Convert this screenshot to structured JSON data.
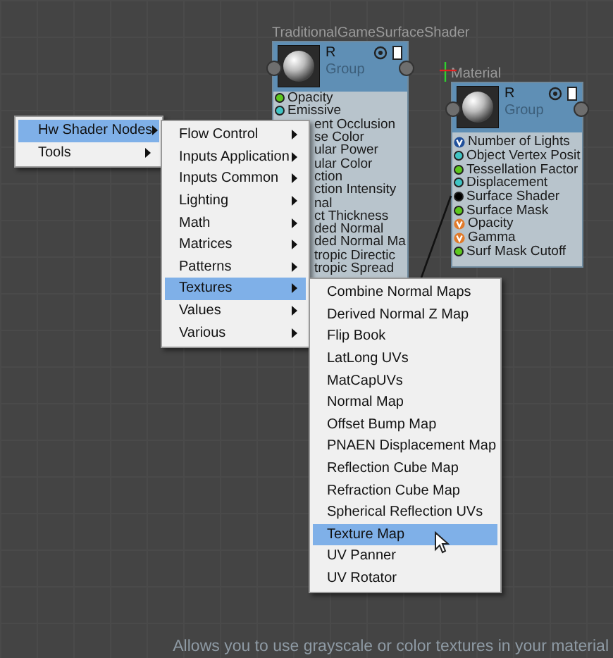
{
  "nodes": [
    {
      "title": "TraditionalGameSurfaceShader",
      "name": "R",
      "group": "Group",
      "ports": [
        {
          "label": "Opacity",
          "kind": "dot",
          "color": "#5cc81e"
        },
        {
          "label": "Emissive",
          "kind": "dot",
          "color": "#3fc4c4"
        },
        {
          "label": "ent Occlusion",
          "kind": "covered"
        },
        {
          "label": "se Color",
          "kind": "covered"
        },
        {
          "label": "ular Power",
          "kind": "covered"
        },
        {
          "label": "ular Color",
          "kind": "covered"
        },
        {
          "label": "ction",
          "kind": "covered"
        },
        {
          "label": "ction Intensity",
          "kind": "covered"
        },
        {
          "label": "nal",
          "kind": "covered"
        },
        {
          "label": "ct Thickness",
          "kind": "covered"
        },
        {
          "label": "ded Normal",
          "kind": "covered"
        },
        {
          "label": "ded Normal Ma",
          "kind": "covered"
        },
        {
          "label": "tropic Directic",
          "kind": "covered"
        },
        {
          "label": "tropic Spread",
          "kind": "covered"
        }
      ]
    },
    {
      "title": "Material",
      "name": "R",
      "group": "Group",
      "ports": [
        {
          "label": "Number of Lights",
          "kind": "v",
          "color": "#1f4f9a"
        },
        {
          "label": "Object Vertex Posit",
          "kind": "dot",
          "color": "#3fc4c4"
        },
        {
          "label": "Tessellation Factor",
          "kind": "dot",
          "color": "#5cc81e"
        },
        {
          "label": "Displacement",
          "kind": "dot",
          "color": "#3fc4c4"
        },
        {
          "label": "Surface Shader",
          "kind": "dot",
          "color": "#000000"
        },
        {
          "label": "Surface Mask",
          "kind": "dot",
          "color": "#5cc81e"
        },
        {
          "label": "Opacity",
          "kind": "v",
          "color": "#e07a2a"
        },
        {
          "label": "Gamma",
          "kind": "v",
          "color": "#e07a2a"
        },
        {
          "label": "Surf Mask Cutoff",
          "kind": "dot",
          "color": "#5cc81e"
        }
      ]
    }
  ],
  "menus": [
    [
      {
        "label": "Hw Shader Nodes",
        "selected": true,
        "submenu": true
      },
      {
        "label": "Tools",
        "selected": false,
        "submenu": true
      }
    ],
    [
      {
        "label": "Flow Control",
        "selected": false,
        "submenu": true
      },
      {
        "label": "Inputs Application",
        "selected": false,
        "submenu": true
      },
      {
        "label": "Inputs Common",
        "selected": false,
        "submenu": true
      },
      {
        "label": "Lighting",
        "selected": false,
        "submenu": true
      },
      {
        "label": "Math",
        "selected": false,
        "submenu": true
      },
      {
        "label": "Matrices",
        "selected": false,
        "submenu": true
      },
      {
        "label": "Patterns",
        "selected": false,
        "submenu": true
      },
      {
        "label": "Textures",
        "selected": true,
        "submenu": true
      },
      {
        "label": "Values",
        "selected": false,
        "submenu": true
      },
      {
        "label": "Various",
        "selected": false,
        "submenu": true
      }
    ],
    [
      {
        "label": "Combine Normal Maps",
        "selected": false,
        "submenu": false
      },
      {
        "label": "Derived Normal Z Map",
        "selected": false,
        "submenu": false
      },
      {
        "label": "Flip Book",
        "selected": false,
        "submenu": false
      },
      {
        "label": "LatLong UVs",
        "selected": false,
        "submenu": false
      },
      {
        "label": "MatCapUVs",
        "selected": false,
        "submenu": false
      },
      {
        "label": "Normal Map",
        "selected": false,
        "submenu": false
      },
      {
        "label": "Offset Bump Map",
        "selected": false,
        "submenu": false
      },
      {
        "label": "PNAEN Displacement Map",
        "selected": false,
        "submenu": false
      },
      {
        "label": "Reflection Cube Map",
        "selected": false,
        "submenu": false
      },
      {
        "label": "Refraction Cube Map",
        "selected": false,
        "submenu": false
      },
      {
        "label": "Spherical Reflection UVs",
        "selected": false,
        "submenu": false
      },
      {
        "label": "Texture Map",
        "selected": true,
        "submenu": false
      },
      {
        "label": "UV Panner",
        "selected": false,
        "submenu": false
      },
      {
        "label": "UV Rotator",
        "selected": false,
        "submenu": false
      }
    ]
  ],
  "status": "Allows you to use grayscale or color textures in your material"
}
